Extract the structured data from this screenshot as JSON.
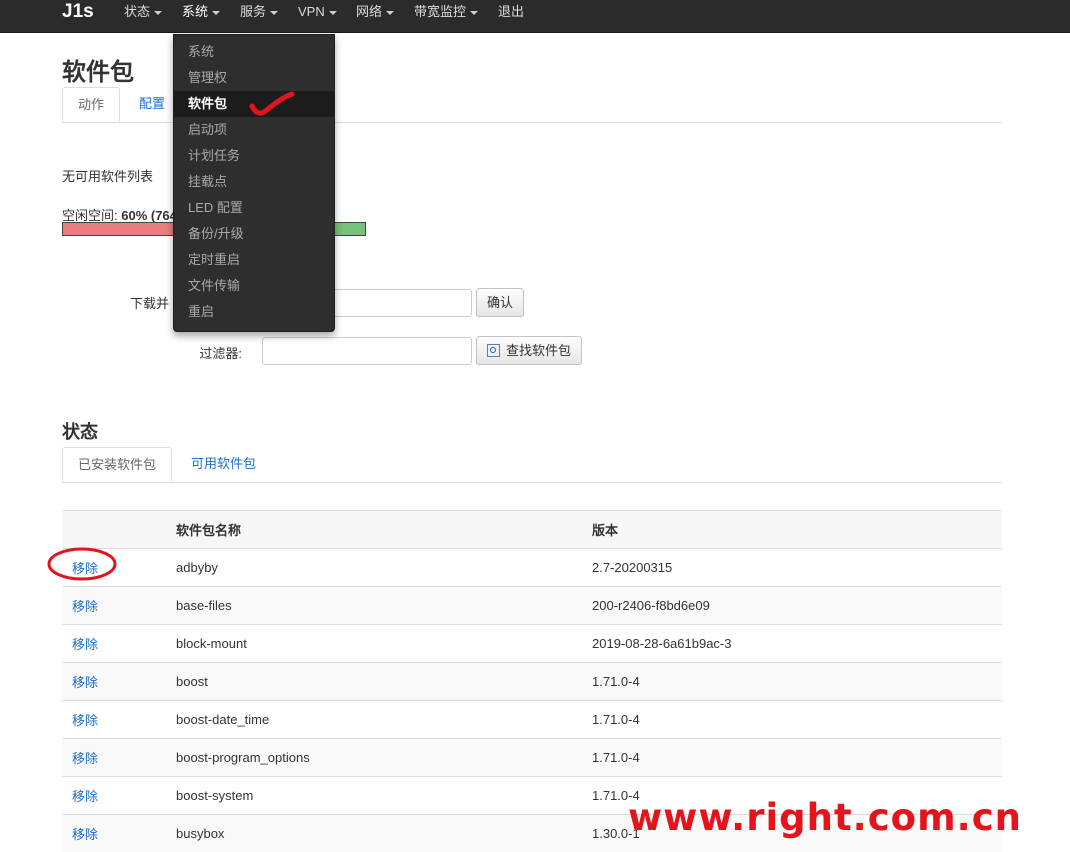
{
  "brand": "J1s",
  "nav": [
    {
      "label": "状态"
    },
    {
      "label": "系统"
    },
    {
      "label": "服务"
    },
    {
      "label": "VPN"
    },
    {
      "label": "网络"
    },
    {
      "label": "带宽监控"
    },
    {
      "label": "退出"
    }
  ],
  "dropdown": {
    "items": [
      "系统",
      "管理权",
      "软件包",
      "启动项",
      "计划任务",
      "挂载点",
      "LED 配置",
      "备份/升级",
      "定时重启",
      "文件传输",
      "重启"
    ],
    "selected": "软件包"
  },
  "page": {
    "title": "软件包",
    "tabs": [
      "动作",
      "配置"
    ],
    "no_list_text": "无可用软件列表",
    "free_space_label": "空闲空间: ",
    "free_space_value": "60% (764",
    "free_space_percent": 60,
    "download_label": "下载并",
    "confirm_button": "确认",
    "filter_label": "过滤器:",
    "find_button": "查找软件包"
  },
  "status": {
    "title": "状态",
    "tabs": [
      "已安装软件包",
      "可用软件包"
    ],
    "table": {
      "headers": [
        "",
        "软件包名称",
        "版本"
      ],
      "action_label": "移除",
      "rows": [
        {
          "name": "adbyby",
          "version": "2.7-20200315"
        },
        {
          "name": "base-files",
          "version": "200-r2406-f8bd6e09"
        },
        {
          "name": "block-mount",
          "version": "2019-08-28-6a61b9ac-3"
        },
        {
          "name": "boost",
          "version": "1.71.0-4"
        },
        {
          "name": "boost-date_time",
          "version": "1.71.0-4"
        },
        {
          "name": "boost-program_options",
          "version": "1.71.0-4"
        },
        {
          "name": "boost-system",
          "version": "1.71.0-4"
        },
        {
          "name": "busybox",
          "version": "1.30.0-1"
        }
      ]
    }
  },
  "watermark": "www.right.com.cn",
  "colors": {
    "navbar": "#2b2b2b",
    "link": "#1f6ec7",
    "used_bar": "#ea7d7d",
    "free_bar": "#78c17a",
    "annotation": "#e3141b"
  }
}
